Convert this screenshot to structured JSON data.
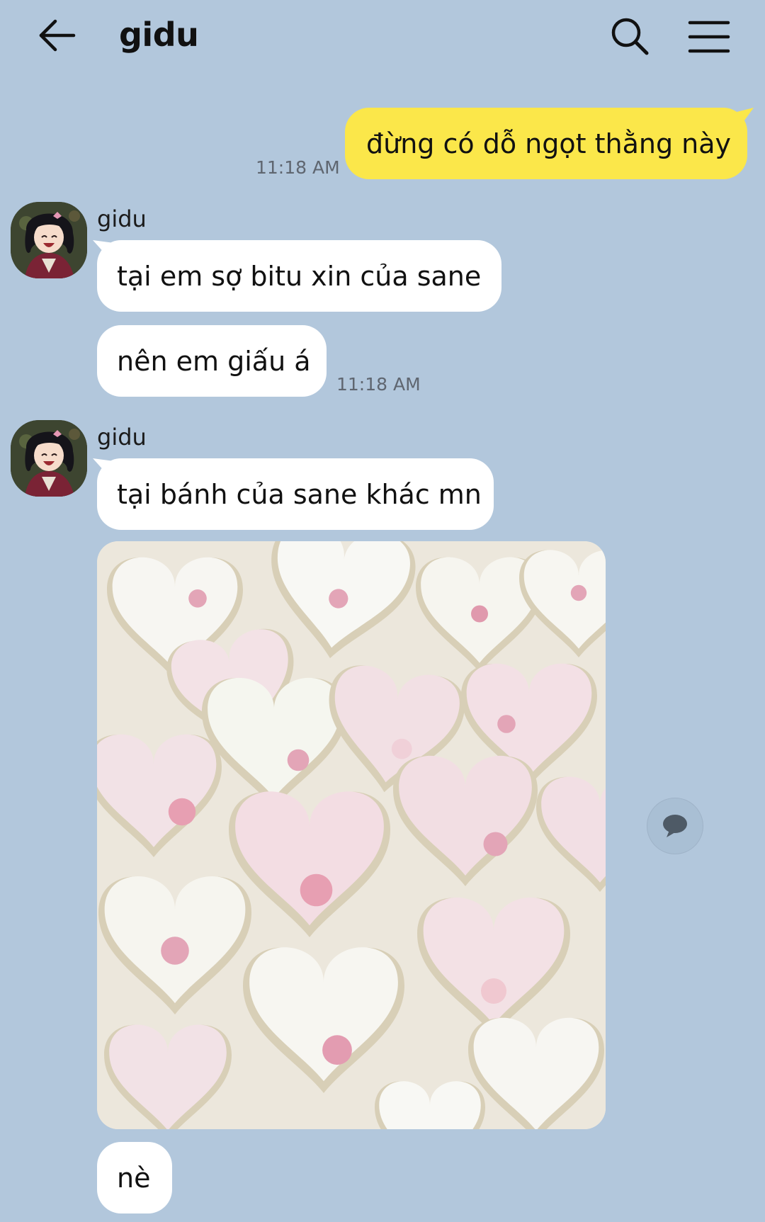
{
  "header": {
    "title": "gidu",
    "back_icon": "arrow-left-icon",
    "search_icon": "search-icon",
    "menu_icon": "hamburger-menu-icon"
  },
  "messages": [
    {
      "from": "me",
      "text": "đừng có dỗ ngọt thằng này",
      "time": "11:18 AM"
    },
    {
      "from": "gidu",
      "sender": "gidu",
      "text": "tại em sợ bitu xin của sane"
    },
    {
      "from": "gidu",
      "text": "nên em giấu á",
      "time": "11:18 AM"
    },
    {
      "from": "gidu",
      "sender": "gidu",
      "text": "tại bánh của sane khác mn"
    },
    {
      "from": "gidu",
      "type": "image",
      "image_desc_icon": "photo-heart-cookies"
    },
    {
      "from": "gidu",
      "text": "nè"
    }
  ],
  "colors": {
    "background": "#b2c7dc",
    "my_bubble": "#fbe74a",
    "their_bubble": "#ffffff",
    "time_text": "#5f6670"
  },
  "icons": {
    "comment": "speech-bubble-icon"
  }
}
